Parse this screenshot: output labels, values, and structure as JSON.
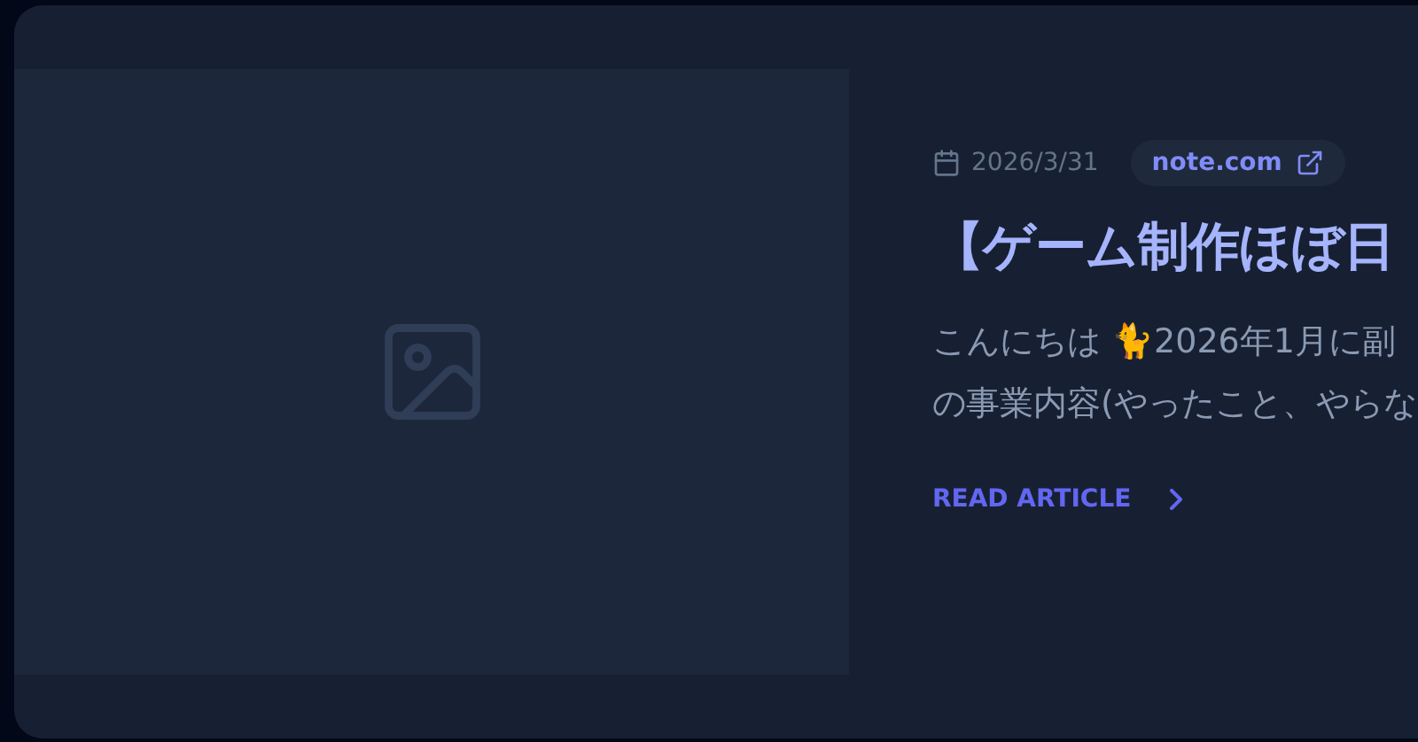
{
  "article": {
    "image": {
      "kind": "placeholder"
    },
    "date": "2026/3/31",
    "source": "note.com",
    "title": "【ゲーム制作ほぼ日",
    "excerpt_lines": [
      "こんにちは 🐈2026年1月に副",
      "の事業内容(やったこと、やらな"
    ],
    "read_more": "READ ARTICLE"
  }
}
